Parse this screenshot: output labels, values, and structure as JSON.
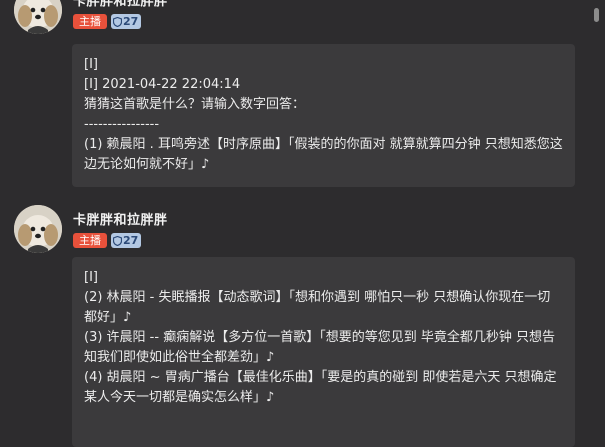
{
  "messages": [
    {
      "user": "卡胖胖和拉胖胖",
      "host_badge": "主播",
      "level": "27",
      "lines": [
        "[I]",
        "[I] 2021-04-22 22:04:14",
        "猜猜这首歌是什么？请输入数字回答：",
        "----------------",
        "(1) 赖晨阳 . 耳鸣旁述【时序原曲】「假装的的你面对 就算就算四分钟 只想知悉您这边无论如何就不好」♪"
      ]
    },
    {
      "user": "卡胖胖和拉胖胖",
      "host_badge": "主播",
      "level": "27",
      "lines": [
        "[I]",
        "(2) 林晨阳 - 失眠播报【动态歌词】「想和你遇到 哪怕只一秒 只想确认你现在一切都好」♪",
        "(3) 许晨阳 -- 癫痫解说【多方位一首歌】「想要的等您见到 毕竟全都几秒钟 只想告知我们即使如此俗世全都差劲」♪",
        "(4) 胡晨阳 ~ 胃病广播台【最佳化乐曲】「要是的真的碰到 即使若是六天 只想确定某人今天一切都是确实怎么样」♪"
      ]
    }
  ],
  "colors": {
    "background": "#2d2c2e",
    "bubble": "#3b3a3c",
    "host_badge": "#e8513b",
    "level_badge": "#b3c8e3"
  }
}
